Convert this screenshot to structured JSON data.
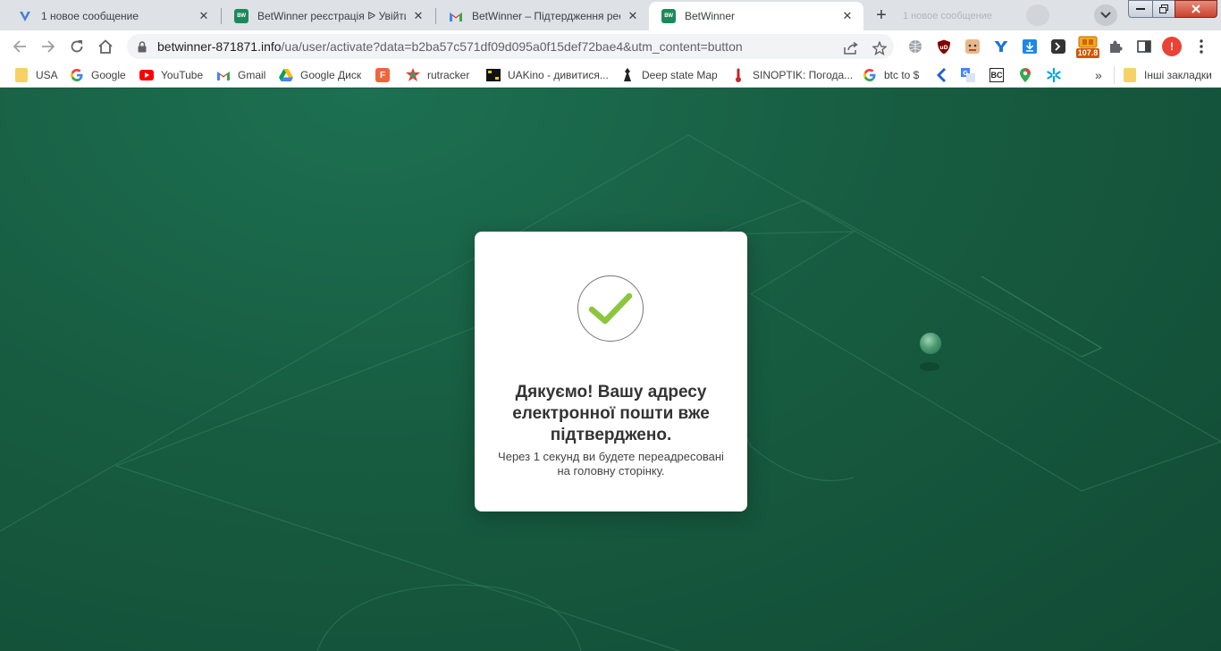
{
  "tabs": [
    {
      "title": "1 новое сообщение",
      "favicon": "v-icon"
    },
    {
      "title": "BetWinner реєстрація ᐉ Увійти в",
      "favicon": "betwinner-icon"
    },
    {
      "title": "BetWinner – Підтердження реєс",
      "favicon": "gmail-icon"
    },
    {
      "title": "BetWinner",
      "favicon": "betwinner-icon",
      "active": true
    }
  ],
  "favicon_text": "BW",
  "ghost_tab_title": "1 новое сообщение",
  "address": {
    "host": "betwinner-871871.info",
    "path": "/ua/user/activate?data=b2ba57c571df09d095a0f15def72bae4&utm_content=button"
  },
  "extensions": {
    "counter_badge": "107.8"
  },
  "bookmarks": [
    {
      "label": "USA",
      "icon": "folder-icon"
    },
    {
      "label": "Google",
      "icon": "google-icon"
    },
    {
      "label": "YouTube",
      "icon": "youtube-icon"
    },
    {
      "label": "Gmail",
      "icon": "gmail-icon"
    },
    {
      "label": "Google Диск",
      "icon": "drive-icon"
    },
    {
      "label": "",
      "icon": "f-icon"
    },
    {
      "label": "rutracker",
      "icon": "rutracker-icon"
    },
    {
      "label": "UAKino - дивитися...",
      "icon": "uakino-icon"
    },
    {
      "label": "Deep state Map",
      "icon": "deepstate-icon"
    },
    {
      "label": "SINOPTIK: Погода...",
      "icon": "thermometer-icon"
    },
    {
      "label": "btc to $",
      "icon": "google-icon"
    }
  ],
  "other_bookmarks": "Інші закладки",
  "card": {
    "title": "Дякуємо! Вашу адресу електронної пошти вже підтверджено.",
    "subtitle": "Через 1 секунд ви будете переадресовані на головну сторінку."
  },
  "colors": {
    "page_bg": "#175c41",
    "check": "#8cc63f",
    "brand_green": "#1a8a5a"
  }
}
